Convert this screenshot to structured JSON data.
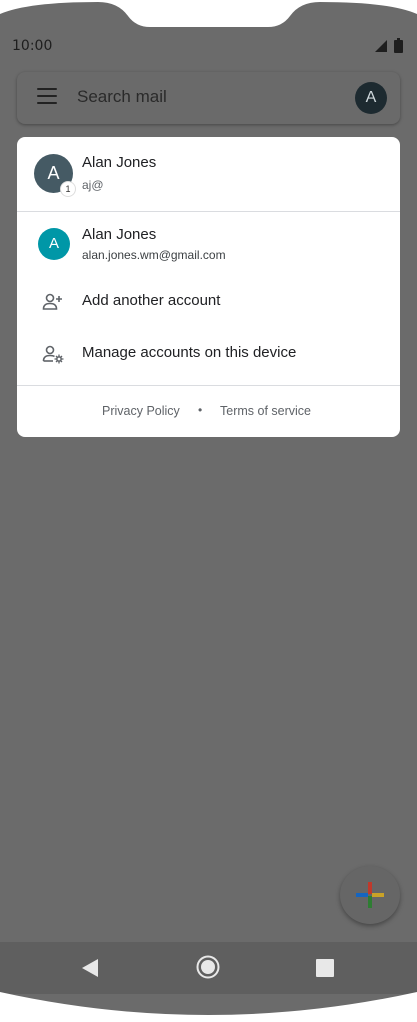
{
  "status_bar": {
    "time": "10:00"
  },
  "search": {
    "placeholder": "Search mail",
    "avatar_letter": "A"
  },
  "account_menu": {
    "current": {
      "initial": "A",
      "badge": "1",
      "name": "Alan Jones",
      "email": "aj@"
    },
    "other": {
      "initial": "A",
      "name": "Alan Jones",
      "email": "alan.jones.wm@gmail.com"
    },
    "actions": [
      {
        "label": "Add another account",
        "icon": "person-add-icon"
      },
      {
        "label": "Manage accounts on this device",
        "icon": "manage-accounts-icon"
      }
    ],
    "footer": {
      "privacy": "Privacy Policy",
      "separator": "•",
      "terms": "Terms of service"
    }
  },
  "colors": {
    "scrim": "#6b6b6b",
    "current_avatar": "#455a64",
    "other_avatar": "#0097a7",
    "search_avatar": "#1d2a30"
  },
  "fab": {
    "icon": "compose-plus-icon"
  },
  "navigation": {
    "back": "back-icon",
    "home": "home-icon",
    "recents": "recents-icon"
  }
}
